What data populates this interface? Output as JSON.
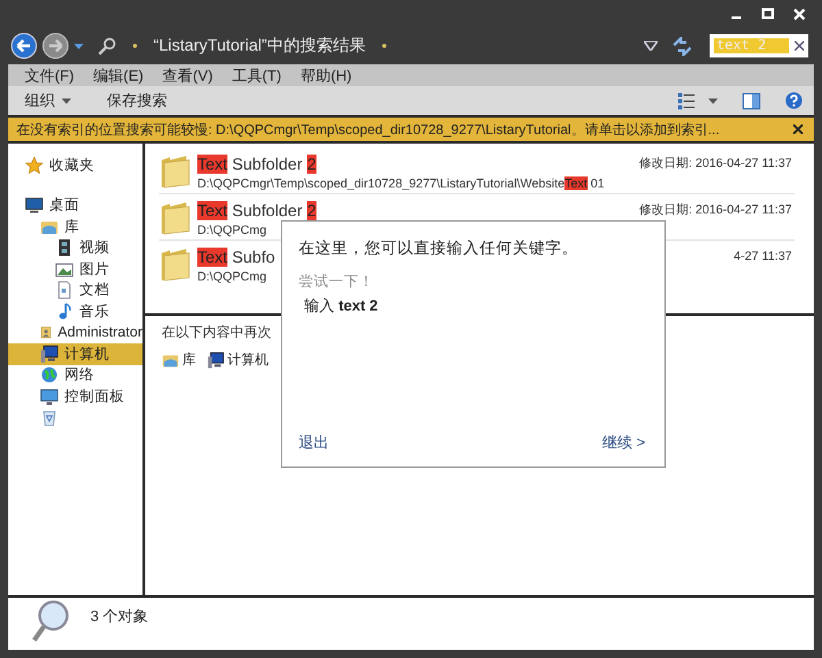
{
  "window": {
    "title": "“ListaryTutorial”中的搜索结果"
  },
  "search": {
    "value": "text 2"
  },
  "menu": [
    "文件(F)",
    "编辑(E)",
    "查看(V)",
    "工具(T)",
    "帮助(H)"
  ],
  "toolbar": [
    {
      "label": "组织",
      "dropdown": true
    },
    {
      "label": "保存搜索",
      "dropdown": false
    }
  ],
  "info_bar": {
    "text": "在没有索引的位置搜索可能较慢: D:\\QQPCmgr\\Temp\\scoped_dir10728_9277\\ListaryTutorial。请单击以添加到索引..."
  },
  "sidebar": {
    "items": [
      {
        "kind": "favorites",
        "label": "收藏夹",
        "selected": false
      },
      {
        "kind": "desktop",
        "label": "桌面",
        "selected": false,
        "children": [
          {
            "kind": "library",
            "label": "库",
            "selected": false,
            "children": [
              {
                "kind": "video",
                "label": "视频",
                "selected": false
              },
              {
                "kind": "picture",
                "label": "图片",
                "selected": false
              },
              {
                "kind": "document",
                "label": "文档",
                "selected": false
              },
              {
                "kind": "music",
                "label": "音乐",
                "selected": false
              }
            ]
          },
          {
            "kind": "user",
            "label": "Administrator",
            "selected": false
          },
          {
            "kind": "computer",
            "label": "计算机",
            "selected": true
          },
          {
            "kind": "network",
            "label": "网络",
            "selected": false
          },
          {
            "kind": "control-panel",
            "label": "控制面板",
            "selected": false
          },
          {
            "kind": "recycle-bin",
            "selected": false
          }
        ]
      }
    ]
  },
  "results": [
    {
      "title": [
        {
          "text": "Text",
          "highlight": true
        },
        {
          "text": " Subfolder ",
          "highlight": false
        },
        {
          "text": "2",
          "highlight": true
        }
      ],
      "path": [
        {
          "text": "D:\\QQPCmgr\\Temp\\scoped_dir10728_9277\\ListaryTutorial\\Website",
          "highlight": false
        },
        {
          "text": "Text",
          "highlight": true
        },
        {
          "text": " 01",
          "highlight": false
        }
      ],
      "date": "修改日期: 2016-04-27 11:37"
    },
    {
      "title": [
        {
          "text": "Text",
          "highlight": true
        },
        {
          "text": " Subfolder ",
          "highlight": false
        },
        {
          "text": "2",
          "highlight": true
        }
      ],
      "path": [
        {
          "text": "D:\\QQPCmg",
          "highlight": false
        }
      ],
      "date": "修改日期: 2016-04-27 11:37"
    },
    {
      "title": [
        {
          "text": "Text",
          "highlight": true
        },
        {
          "text": " Subfo",
          "highlight": false
        }
      ],
      "path": [
        {
          "text": "D:\\QQPCmg",
          "highlight": false
        }
      ],
      "date": "4-27 11:37"
    }
  ],
  "search_again": {
    "label": "在以下内容中再次",
    "items": [
      {
        "kind": "library",
        "label": "库"
      },
      {
        "kind": "computer",
        "label": "计算机"
      }
    ]
  },
  "popup": {
    "heading": "在这里，您可以直接输入任何关键字。",
    "hint": "尝试一下！",
    "example": "输入 **text 2**",
    "quit": "退出",
    "next": "继续 >"
  },
  "status": {
    "count": "3 个对象"
  }
}
